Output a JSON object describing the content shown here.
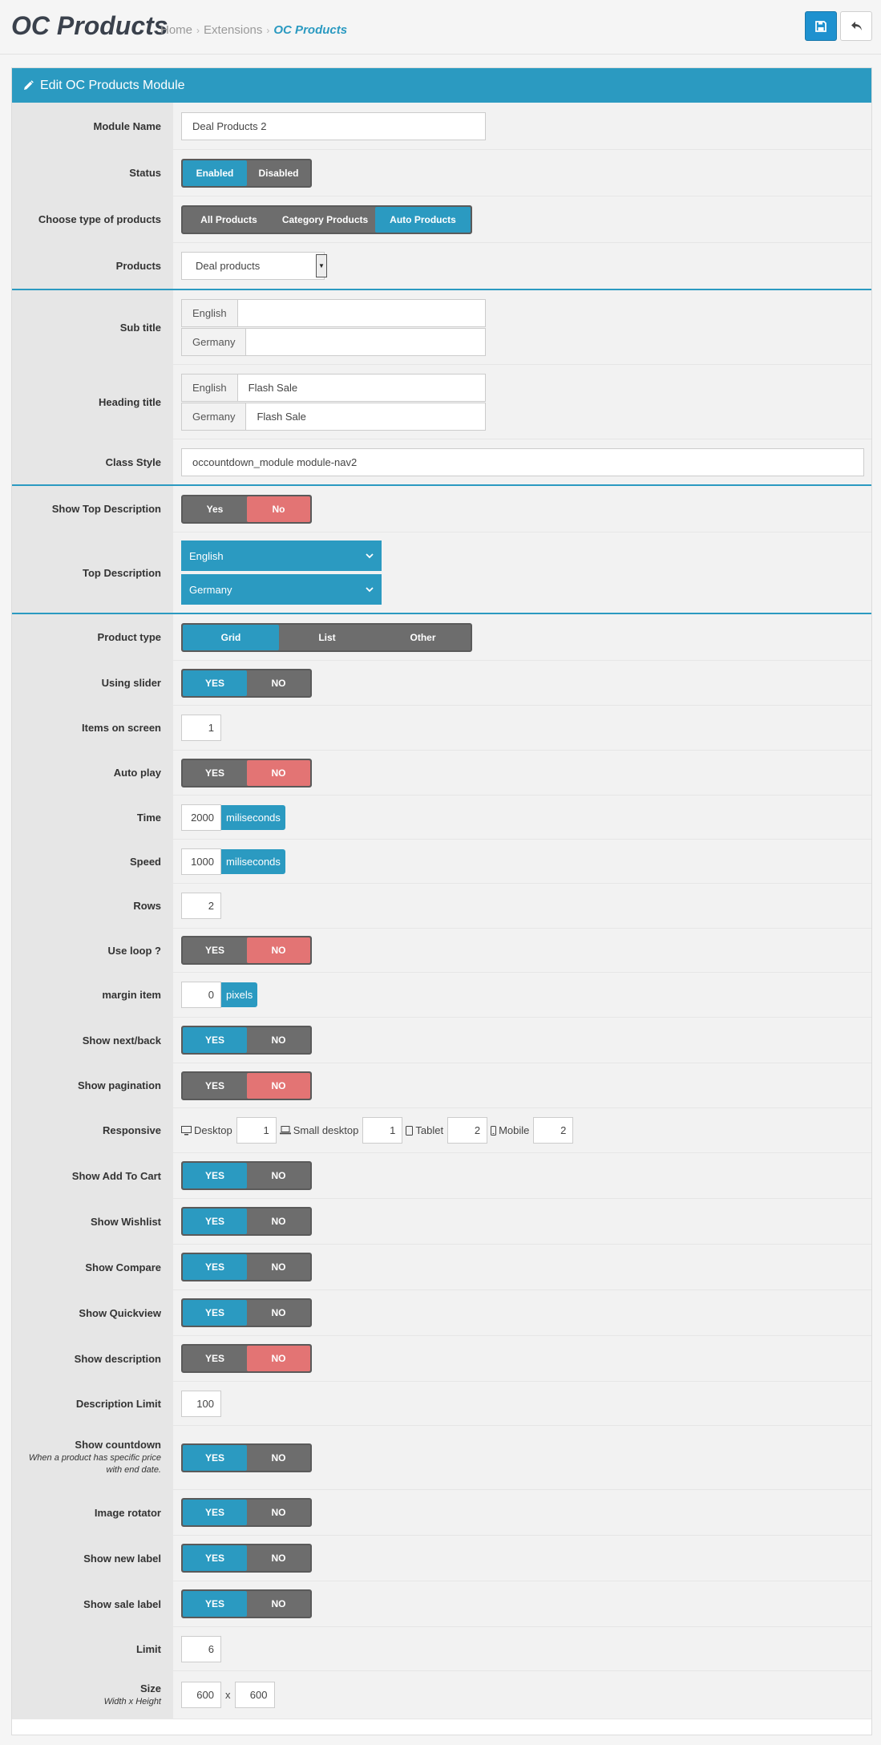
{
  "header": {
    "title": "OC Products",
    "breadcrumb": [
      "Home",
      "Extensions",
      "OC Products"
    ],
    "save_icon": "save-icon",
    "back_icon": "reply-icon"
  },
  "panel": {
    "heading": "Edit OC Products Module",
    "heading_icon": "pencil-icon"
  },
  "colors": {
    "accent": "#2b9ac1",
    "off": "#6d6d6d",
    "danger": "#e37474"
  },
  "form": {
    "module_name": {
      "label": "Module Name",
      "value": "Deal Products 2"
    },
    "status": {
      "label": "Status",
      "options": [
        "Enabled",
        "Disabled"
      ],
      "selected": "Enabled"
    },
    "choose_type": {
      "label": "Choose type of products",
      "options": [
        "All Products",
        "Category Products",
        "Auto Products"
      ],
      "selected": "Auto Products"
    },
    "products": {
      "label": "Products",
      "value": "Deal products"
    },
    "sub_title": {
      "label": "Sub title",
      "langs": [
        {
          "lang": "English",
          "value": ""
        },
        {
          "lang": "Germany",
          "value": ""
        }
      ]
    },
    "heading_title": {
      "label": "Heading title",
      "langs": [
        {
          "lang": "English",
          "value": "Flash Sale"
        },
        {
          "lang": "Germany",
          "value": "Flash Sale"
        }
      ]
    },
    "class_style": {
      "label": "Class Style",
      "value": "occountdown_module module-nav2"
    },
    "show_top_desc": {
      "label": "Show Top Description",
      "options": [
        "Yes",
        "No"
      ],
      "selected": "No"
    },
    "top_desc": {
      "label": "Top Description",
      "items": [
        "English",
        "Germany"
      ]
    },
    "product_type": {
      "label": "Product type",
      "options": [
        "Grid",
        "List",
        "Other"
      ],
      "selected": "Grid"
    },
    "using_slider": {
      "label": "Using slider",
      "options": [
        "YES",
        "NO"
      ],
      "selected": "YES"
    },
    "items_on_screen": {
      "label": "Items on screen",
      "value": "1"
    },
    "auto_play": {
      "label": "Auto play",
      "options": [
        "YES",
        "NO"
      ],
      "selected": "NO"
    },
    "time": {
      "label": "Time",
      "value": "2000",
      "unit": "miliseconds"
    },
    "speed": {
      "label": "Speed",
      "value": "1000",
      "unit": "miliseconds"
    },
    "rows": {
      "label": "Rows",
      "value": "2"
    },
    "use_loop": {
      "label": "Use loop ?",
      "options": [
        "YES",
        "NO"
      ],
      "selected": "NO"
    },
    "margin_item": {
      "label": "margin item",
      "value": "0",
      "unit": "pixels"
    },
    "show_next_back": {
      "label": "Show next/back",
      "options": [
        "YES",
        "NO"
      ],
      "selected": "YES"
    },
    "show_pagination": {
      "label": "Show pagination",
      "options": [
        "YES",
        "NO"
      ],
      "selected": "NO"
    },
    "responsive": {
      "label": "Responsive",
      "items": [
        {
          "icon": "desktop-icon",
          "name": "Desktop",
          "value": "1"
        },
        {
          "icon": "laptop-icon",
          "name": "Small desktop",
          "value": "1"
        },
        {
          "icon": "tablet-icon",
          "name": "Tablet",
          "value": "2"
        },
        {
          "icon": "mobile-icon",
          "name": "Mobile",
          "value": "2"
        }
      ]
    },
    "show_add_to_cart": {
      "label": "Show Add To Cart",
      "options": [
        "YES",
        "NO"
      ],
      "selected": "YES"
    },
    "show_wishlist": {
      "label": "Show Wishlist",
      "options": [
        "YES",
        "NO"
      ],
      "selected": "YES"
    },
    "show_compare": {
      "label": "Show Compare",
      "options": [
        "YES",
        "NO"
      ],
      "selected": "YES"
    },
    "show_quickview": {
      "label": "Show Quickview",
      "options": [
        "YES",
        "NO"
      ],
      "selected": "YES"
    },
    "show_description": {
      "label": "Show description",
      "options": [
        "YES",
        "NO"
      ],
      "selected": "NO"
    },
    "description_limit": {
      "label": "Description Limit",
      "value": "100"
    },
    "show_countdown": {
      "label": "Show countdown",
      "help": "When a product has specific price with end date.",
      "options": [
        "YES",
        "NO"
      ],
      "selected": "YES"
    },
    "image_rotator": {
      "label": "Image rotator",
      "options": [
        "YES",
        "NO"
      ],
      "selected": "YES"
    },
    "show_new_label": {
      "label": "Show new label",
      "options": [
        "YES",
        "NO"
      ],
      "selected": "YES"
    },
    "show_sale_label": {
      "label": "Show sale label",
      "options": [
        "YES",
        "NO"
      ],
      "selected": "YES"
    },
    "limit": {
      "label": "Limit",
      "value": "6"
    },
    "size": {
      "label": "Size",
      "help": "Width x Height",
      "width": "600",
      "separator": "x",
      "height": "600"
    }
  }
}
